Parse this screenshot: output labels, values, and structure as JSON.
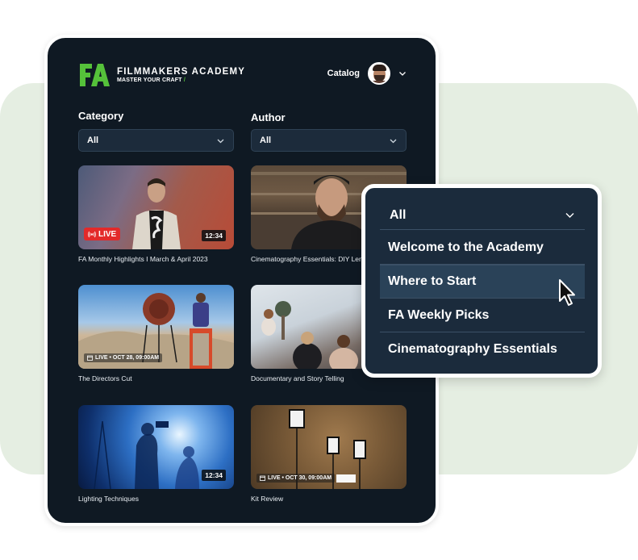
{
  "brand": {
    "logo_mark": "FA",
    "title": "FILMMAKERS ACADEMY",
    "subtitle": "MASTER YOUR CRAFT",
    "accent_color": "#55c13a"
  },
  "header": {
    "catalog_label": "Catalog",
    "avatar_icon": "user-avatar",
    "menu_icon": "chevron-down-icon"
  },
  "filters": {
    "category": {
      "label": "Category",
      "value": "All"
    },
    "author": {
      "label": "Author",
      "value": "All"
    }
  },
  "videos": [
    {
      "title": "FA Monthly Highlights I March & April 2023",
      "badge": "LIVE",
      "duration": "12:34",
      "schedule": null
    },
    {
      "title": "Cinematography Essentials: DIY Lens",
      "badge": null,
      "duration": null,
      "schedule": null
    },
    {
      "title": "The Directors Cut",
      "badge": null,
      "duration": null,
      "schedule": "LIVE • OCT 28, 09:00AM"
    },
    {
      "title": "Documentary and Story Telling",
      "badge": null,
      "duration": null,
      "schedule": null
    },
    {
      "title": "Lighting Techniques",
      "badge": null,
      "duration": "12:34",
      "schedule": null
    },
    {
      "title": "Kit Review",
      "badge": null,
      "duration": null,
      "schedule": "LIVE • OCT 30, 09:00AM"
    }
  ],
  "dropdown": {
    "selected": "All",
    "options": [
      "Welcome to the Academy",
      "Where to Start",
      "FA Weekly Picks",
      "Cinematography Essentials"
    ],
    "hovered": "Where to Start"
  },
  "colors": {
    "panel_bg": "#0f1923",
    "select_bg": "#1c2b3b",
    "live_red": "#e32a2a",
    "dropdown_bg": "#1b2b3c",
    "hover_bg": "#2a4258",
    "page_accent_bg": "#e5eee2"
  }
}
